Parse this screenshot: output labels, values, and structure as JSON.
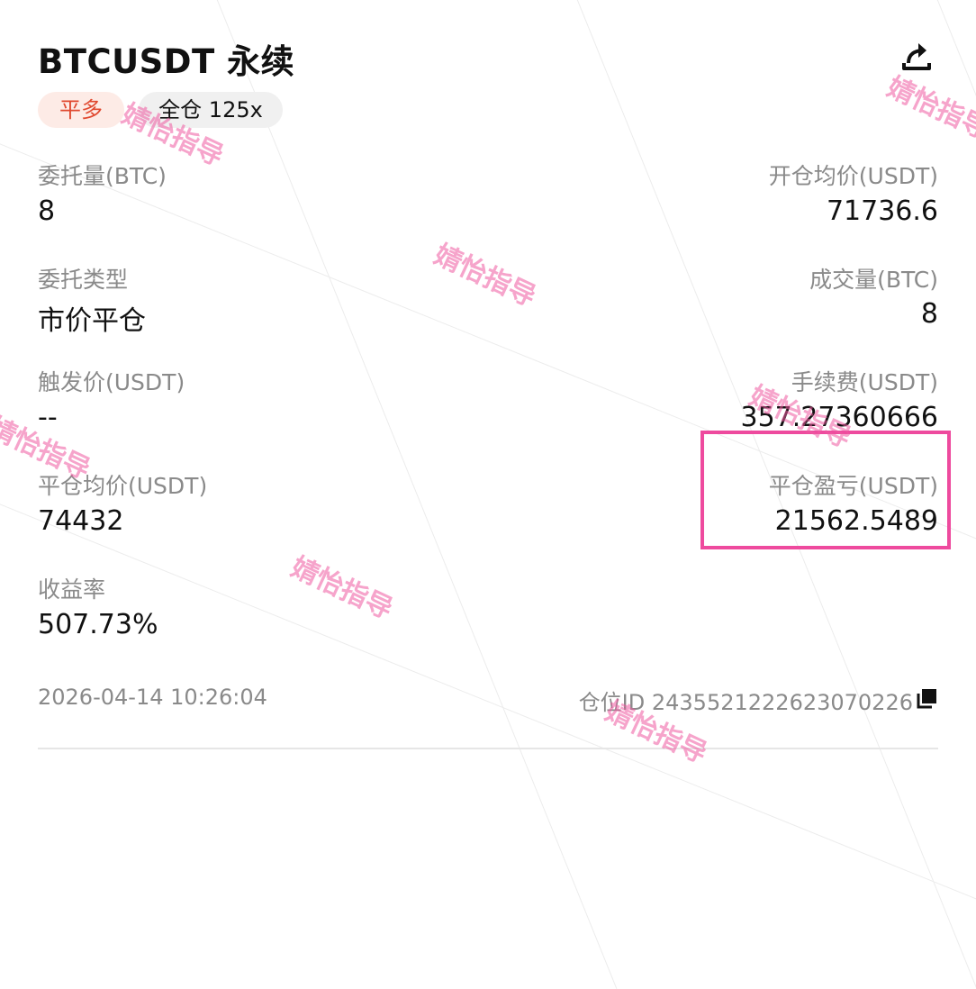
{
  "header": {
    "title": "BTCUSDT 永续"
  },
  "badges": {
    "side": "平多",
    "margin": "全仓 125x"
  },
  "fields": {
    "order_qty_label": "委托量(BTC)",
    "order_qty": "8",
    "open_avg_label": "开仓均价(USDT)",
    "open_avg": "71736.6",
    "order_type_label": "委托类型",
    "order_type": "市价平仓",
    "filled_label": "成交量(BTC)",
    "filled": "8",
    "trigger_label": "触发价(USDT)",
    "trigger": "--",
    "fee_label": "手续费(USDT)",
    "fee": "357.27360666",
    "close_avg_label": "平仓均价(USDT)",
    "close_avg": "74432",
    "pnl_label": "平仓盈亏(USDT)",
    "pnl": "21562.5489",
    "roi_label": "收益率",
    "roi": "507.73%"
  },
  "footer": {
    "timestamp": "2026-04-14 10:26:04",
    "position_id": "仓位ID 2435521222623070226"
  },
  "watermark": {
    "text": "婧怡指导",
    "color": "#ee5aa0"
  },
  "colors": {
    "highlight": "#ee4a9e",
    "side_badge_bg": "#fdebe6",
    "side_badge_text": "#e0482f"
  },
  "icons": {
    "share": "share-icon",
    "copy": "copy-icon"
  }
}
